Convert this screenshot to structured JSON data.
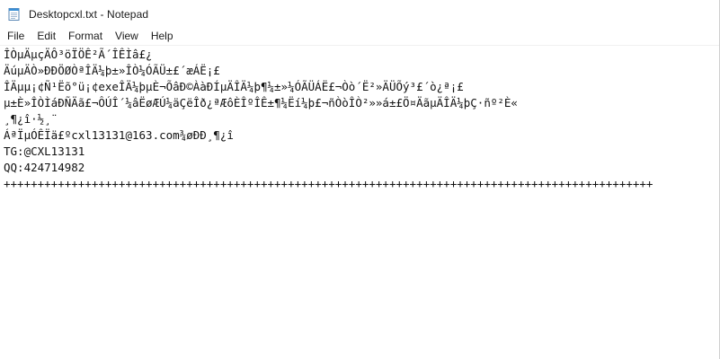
{
  "window": {
    "title": "Desktopcxl.txt - Notepad"
  },
  "menu": {
    "items": [
      {
        "label": "File"
      },
      {
        "label": "Edit"
      },
      {
        "label": "Format"
      },
      {
        "label": "View"
      },
      {
        "label": "Help"
      }
    ]
  },
  "document": {
    "lines": [
      "ÎÒµÄµçÄÔ³öÏÖÊ²Ã´ÎÊÌâ£¿",
      "ÄúµÄÒ»ÐÐÖØÒªÎÄ¼þ±»ÎÒ¼ÓÃÜ±£´æÁË¡£",
      "ÎÄµµ¡¢Ñ¹Ëõ°ü¡¢exeÎÄ¼þµÈ¬ÕâÐ©ÀàÐÍµÄÎÄ¼þ¶¼±»¼ÓÃÜÁË£¬Òò´Ë²»ÄÜÕý³£´ò¿ª¡£",
      "µ±È»ÎÒÌáÐÑÄã£¬ÔÚÎ´¼âËøÆÚ¼äÇëÎð¿ªÆôÈÎºÎÊ±¶¼Ëí¼þ£¬ñÒòÎÒ²»»á±£Ö¤ÄãµÄÎÄ¼þÇ·ñº²È«",
      "¸¶¿î·½¸¨",
      "ÁªÏµÓÊÏä£ºcxl13131@163.com¾øÐÐ¸¶¿î",
      "TG:@CXL13131",
      "QQ:424714982",
      "++++++++++++++++++++++++++++++++++++++++++++++++++++++++++++++++++++++++++++++++++++++++++++++++"
    ]
  },
  "colors": {
    "background": "#ffffff",
    "text": "#111111",
    "icon_blue": "#3b8fd6"
  }
}
